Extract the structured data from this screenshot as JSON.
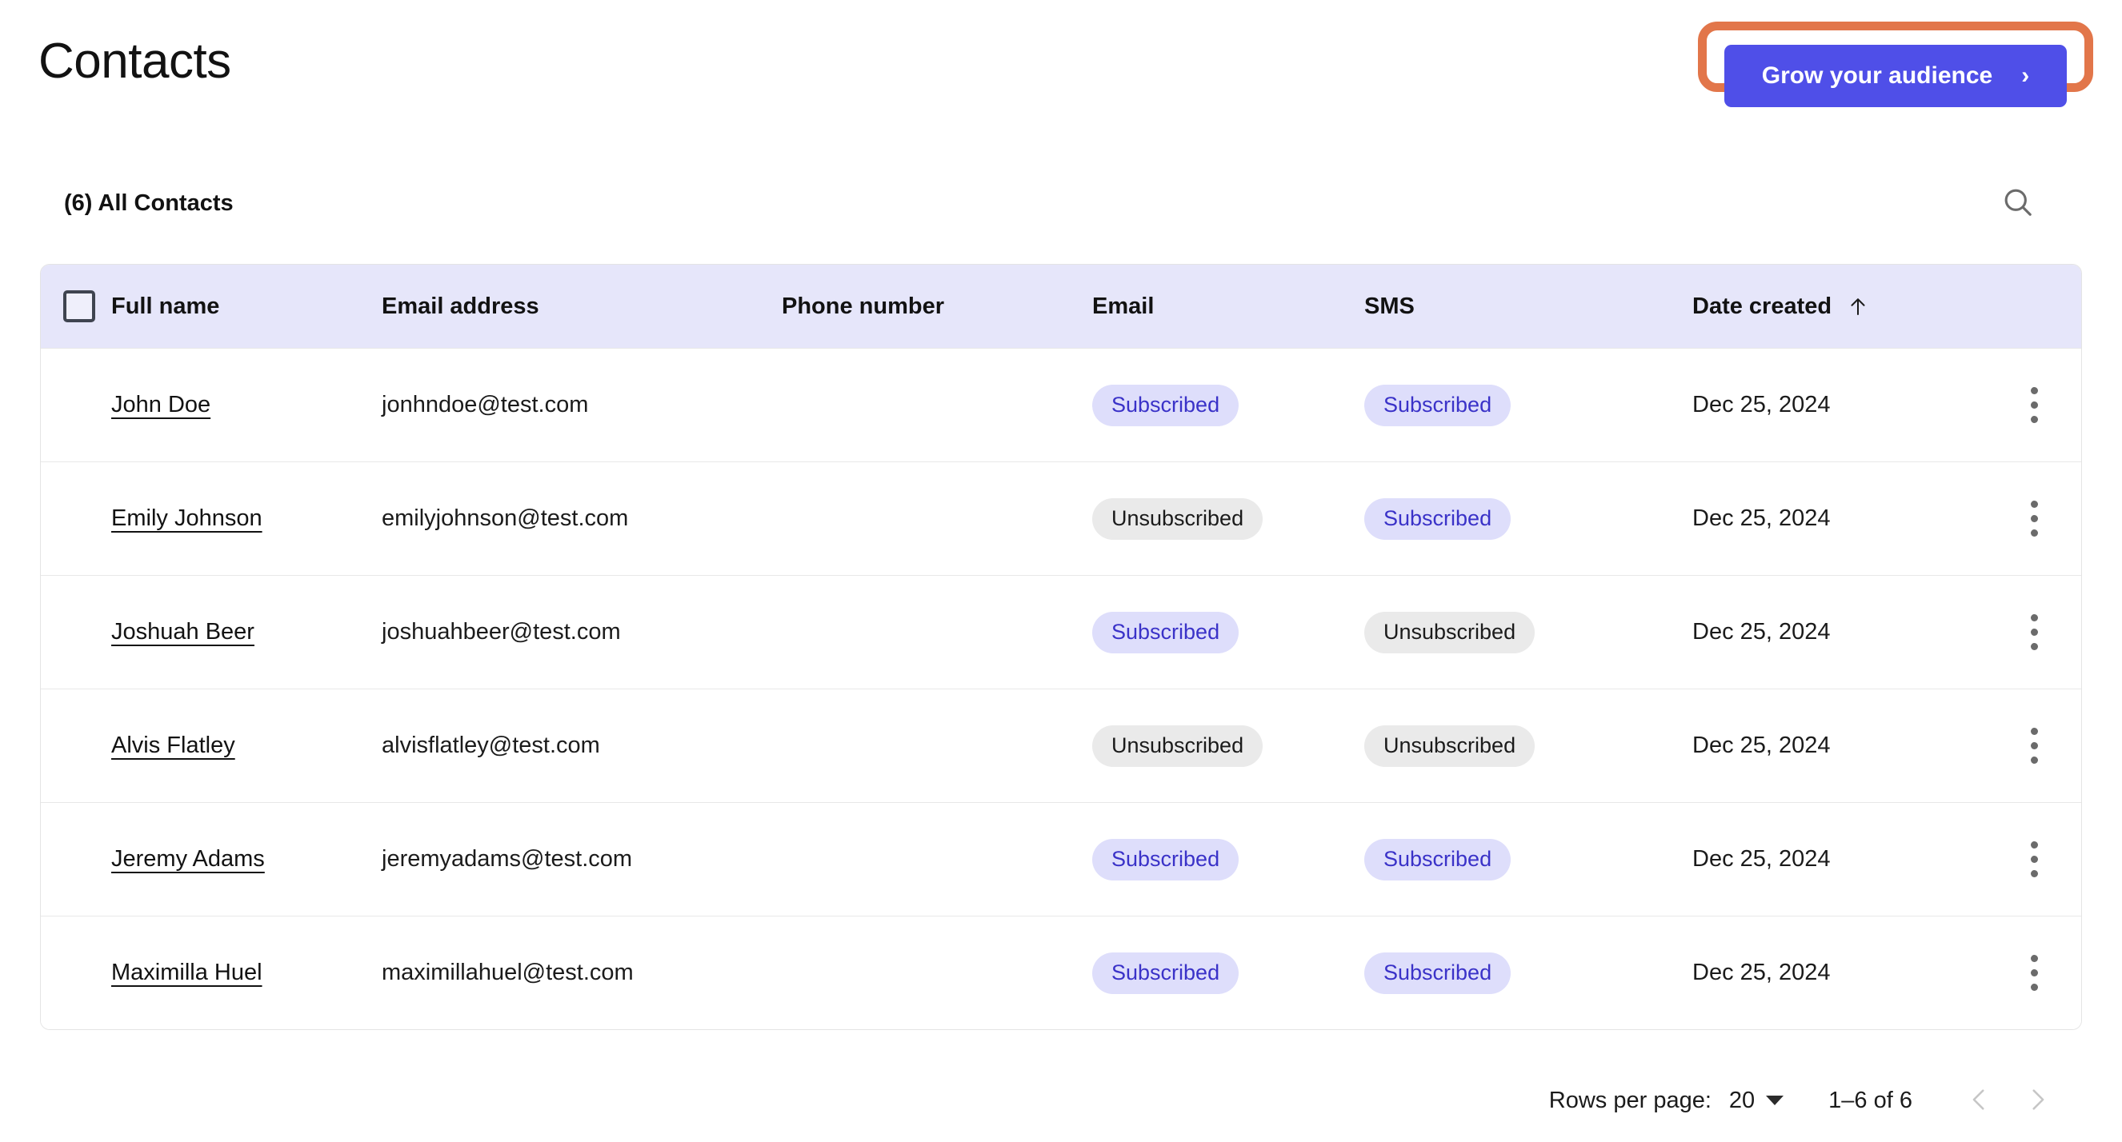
{
  "header": {
    "title": "Contacts",
    "cta_label": "Grow your audience",
    "cta_chevron": "›",
    "highlight_color": "#E2764A",
    "cta_color": "#4F4FE8"
  },
  "subheader": {
    "count_label": "(6) All Contacts",
    "search_icon": "search-icon"
  },
  "table": {
    "columns": [
      {
        "key": "select",
        "label": ""
      },
      {
        "key": "full_name",
        "label": "Full name"
      },
      {
        "key": "email_address",
        "label": "Email address"
      },
      {
        "key": "phone_number",
        "label": "Phone number"
      },
      {
        "key": "email",
        "label": "Email"
      },
      {
        "key": "sms",
        "label": "SMS"
      },
      {
        "key": "date_created",
        "label": "Date created"
      }
    ],
    "sort": {
      "column": "Date created",
      "direction": "asc",
      "glyph": "↑"
    },
    "header_bg": "#E6E6FA",
    "rows": [
      {
        "full_name": "John Doe",
        "email_address": "jonhndoe@test.com",
        "phone_number": "",
        "email": "Subscribed",
        "sms": "Subscribed",
        "date_created": "Dec 25, 2024"
      },
      {
        "full_name": "Emily Johnson",
        "email_address": "emilyjohnson@test.com",
        "phone_number": "",
        "email": "Unsubscribed",
        "sms": "Subscribed",
        "date_created": "Dec 25, 2024"
      },
      {
        "full_name": "Joshuah Beer",
        "email_address": "joshuahbeer@test.com",
        "phone_number": "",
        "email": "Subscribed",
        "sms": "Unsubscribed",
        "date_created": "Dec 25, 2024"
      },
      {
        "full_name": "Alvis Flatley",
        "email_address": "alvisflatley@test.com",
        "phone_number": "",
        "email": "Unsubscribed",
        "sms": "Unsubscribed",
        "date_created": "Dec 25, 2024"
      },
      {
        "full_name": "Jeremy Adams",
        "email_address": "jeremyadams@test.com",
        "phone_number": "",
        "email": "Subscribed",
        "sms": "Subscribed",
        "date_created": "Dec 25, 2024"
      },
      {
        "full_name": "Maximilla Huel",
        "email_address": "maximillahuel@test.com",
        "phone_number": "",
        "email": "Subscribed",
        "sms": "Subscribed",
        "date_created": "Dec 25, 2024"
      }
    ]
  },
  "pagination": {
    "rows_per_page_label": "Rows per page:",
    "rows_per_page_value": "20",
    "range_label": "1–6 of 6",
    "prev_glyph": "‹",
    "next_glyph": "›"
  }
}
